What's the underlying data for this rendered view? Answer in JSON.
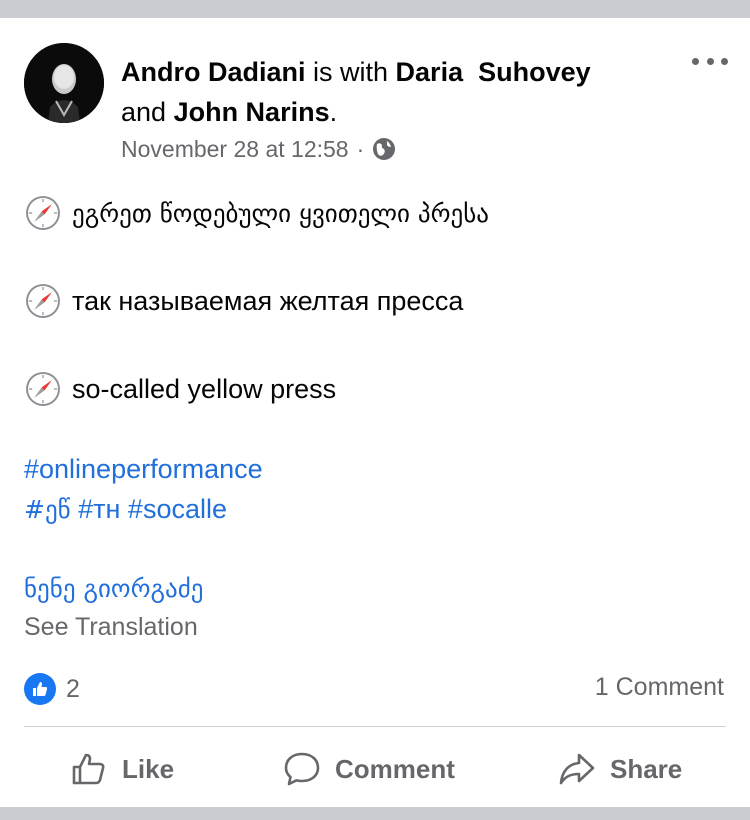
{
  "post": {
    "author": "Andro Dadiani",
    "with_text": " is with ",
    "tagged_1": "Daria  Suhovey",
    "and_text": " and ",
    "tagged_2": "John Narins",
    "period": ".",
    "timestamp": "November 28 at 12:58",
    "separator": "·",
    "privacy_icon": "globe-icon",
    "lines": [
      "ეგრეთ წოდებული ყვითელი პრესა",
      "так называемая желтая пресса",
      "so-called yellow press"
    ],
    "line_icon": "compass-icon",
    "hashtags_row1": [
      "#onlineperformance"
    ],
    "hashtags_row2": [
      "#ეწ",
      "#тн",
      "#socalle"
    ],
    "author_link": "ნენე გიორგაძე",
    "see_translation": "See Translation"
  },
  "stats": {
    "likes_count": "2",
    "comments_text": "1 Comment"
  },
  "actions": {
    "like_label": "Like",
    "comment_label": "Comment",
    "share_label": "Share"
  },
  "colors": {
    "link": "#216fdb",
    "secondary_text": "#65676b",
    "like_badge": "#1877f2",
    "page_background": "#c9ccd1"
  }
}
